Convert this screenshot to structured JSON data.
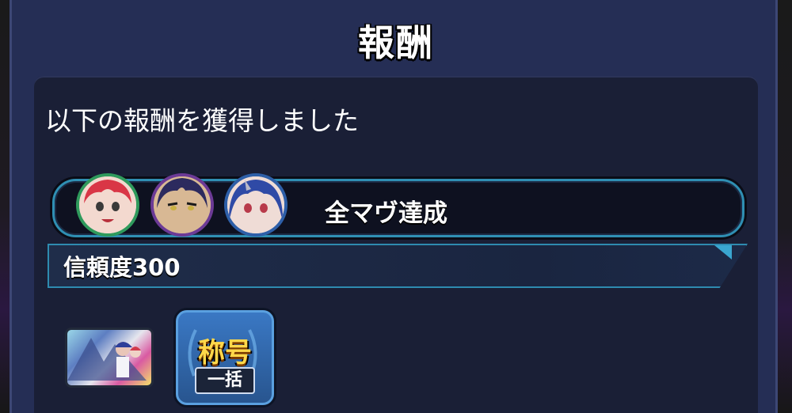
{
  "dialog": {
    "title": "報酬"
  },
  "content": {
    "message": "以下の報酬を獲得しました",
    "mission": {
      "label": "全マヴ達成",
      "avatars": [
        "character-red-hair",
        "character-purple-hair",
        "character-blue-hair"
      ],
      "avatar_border_colors": [
        "#2f9a5c",
        "#6c3a96",
        "#2e5fa8"
      ]
    },
    "reward": {
      "label": "信頼度300"
    },
    "items": [
      {
        "type": "image",
        "icon": "reward-image-thumbnail"
      },
      {
        "type": "title",
        "name": "称号",
        "badge": "一括"
      }
    ]
  }
}
